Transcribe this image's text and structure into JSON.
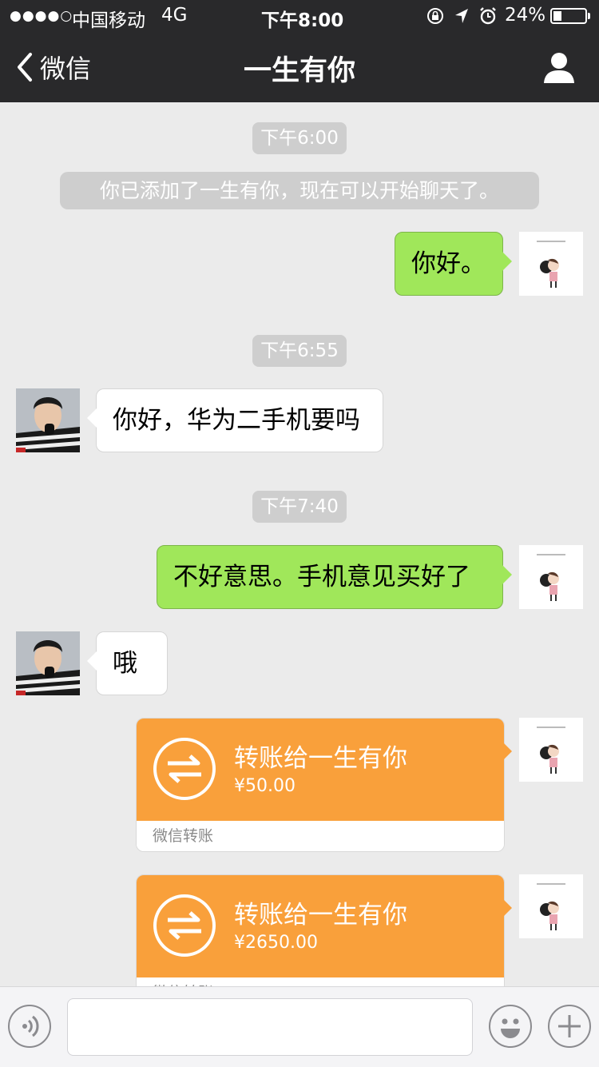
{
  "status_bar": {
    "signal_dots": "●●●●○",
    "carrier": "中国移动",
    "network": "4G",
    "time": "下午8:00",
    "battery": "24%"
  },
  "nav": {
    "back_label": "微信",
    "title": "一生有你"
  },
  "chat": {
    "times": [
      "下午6:00",
      "下午6:55",
      "下午7:40"
    ],
    "system_notice": "你已添加了一生有你，现在可以开始聊天了。",
    "messages": [
      {
        "from": "me",
        "text": "你好。"
      },
      {
        "from": "contact",
        "text": "你好，华为二手机要吗"
      },
      {
        "from": "me",
        "text": "不好意思。手机意见买好了"
      },
      {
        "from": "contact",
        "text": "哦"
      }
    ],
    "transfers": [
      {
        "title": "转账给一生有你",
        "amount": "¥50.00",
        "footer": "微信转账"
      },
      {
        "title": "转账给一生有你",
        "amount": "¥2650.00",
        "footer": "微信转账"
      }
    ]
  },
  "colors": {
    "nav_bg": "#29292b",
    "chat_bg": "#ebebeb",
    "my_bubble": "#a0e75a",
    "transfer_orange": "#f9a03b"
  },
  "icons": [
    "back-chevron-icon",
    "profile-icon",
    "voice-icon",
    "emoji-icon",
    "plus-icon",
    "transfer-icon",
    "location-arrow-icon",
    "alarm-icon",
    "lock-rotation-icon"
  ]
}
